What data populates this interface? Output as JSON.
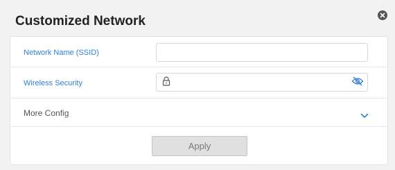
{
  "dialog": {
    "title": "Customized Network",
    "close_icon": "close-circle-icon"
  },
  "form": {
    "ssid": {
      "label": "Network Name (SSID)",
      "value": "",
      "placeholder": ""
    },
    "security": {
      "label": "Wireless Security",
      "value": "",
      "placeholder": "",
      "lock_icon": "lock-icon",
      "visibility_icon": "eye-slash-icon"
    },
    "more": {
      "label": "More Config",
      "expand_icon": "chevron-down-icon"
    },
    "apply_label": "Apply"
  },
  "colors": {
    "label_blue": "#2f7fd8",
    "button_bg": "#e0e0e0",
    "dialog_bg": "#f2f2f2"
  }
}
